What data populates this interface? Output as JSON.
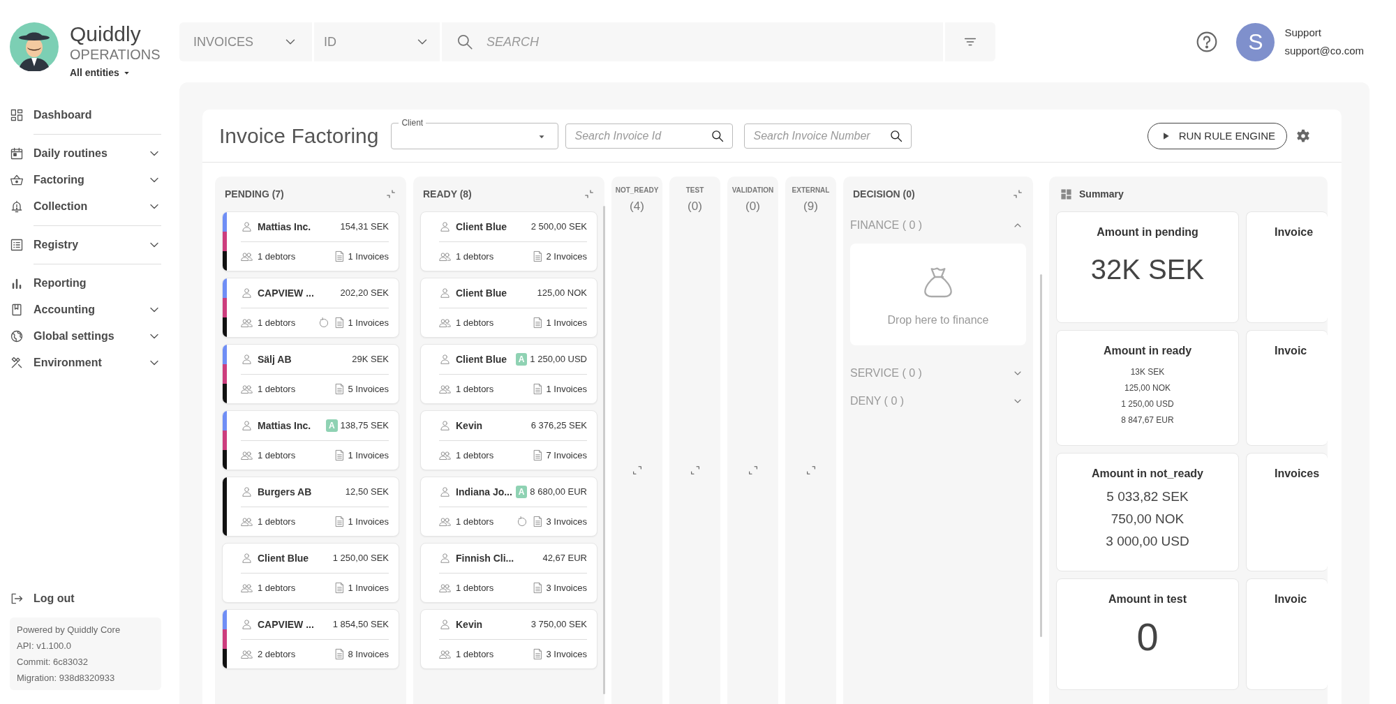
{
  "brand": {
    "name": "Quiddly",
    "subtitle": "OPERATIONS",
    "scope": "All entities"
  },
  "sidebar": {
    "groups": [
      [
        {
          "label": "Dashboard",
          "kind": "dashboard",
          "expandable": false
        }
      ],
      [
        {
          "label": "Daily routines",
          "kind": "calendar",
          "expandable": true
        },
        {
          "label": "Factoring",
          "kind": "basket",
          "expandable": true
        },
        {
          "label": "Collection",
          "kind": "bell",
          "expandable": true
        }
      ],
      [
        {
          "label": "Registry",
          "kind": "list",
          "expandable": true
        }
      ],
      [
        {
          "label": "Reporting",
          "kind": "bars",
          "expandable": false
        },
        {
          "label": "Accounting",
          "kind": "book",
          "expandable": true
        },
        {
          "label": "Global settings",
          "kind": "globe",
          "expandable": true
        },
        {
          "label": "Environment",
          "kind": "tools",
          "expandable": true
        }
      ]
    ],
    "logout": "Log out",
    "footer": [
      "Powered by Quiddly Core",
      "API: v1.100.0",
      "Commit: 6c83032",
      "Migration: 938d8320933"
    ]
  },
  "topbar": {
    "entity_select": "INVOICES",
    "field_select": "ID",
    "search": {
      "placeholder": "SEARCH"
    }
  },
  "user": {
    "initial": "S",
    "name": "Support",
    "email": "support@co.com"
  },
  "page": {
    "title": "Invoice Factoring",
    "client": {
      "label": "Client"
    },
    "invoice_id_search": {
      "placeholder": "Search Invoice Id"
    },
    "invoice_number_search": {
      "placeholder": "Search Invoice Number"
    },
    "run_button": "RUN RULE ENGINE"
  },
  "board": {
    "columns": [
      {
        "kind": "list",
        "title": "PENDING (7)",
        "cards": [
          {
            "client": "Mattias Inc.",
            "amount": "154,31 SEK",
            "debtors": "1 debtors",
            "invoices": "1 Invoices",
            "recurring": false,
            "strip": [
              {
                "color": "#6f8ef5"
              },
              {
                "color": "#cc3d7d"
              },
              {
                "color": "#111111"
              }
            ]
          },
          {
            "client": "CAPVIEW ...",
            "amount": "202,20 SEK",
            "debtors": "1 debtors",
            "invoices": "1 Invoices",
            "recurring": true,
            "strip": [
              {
                "color": "#6f8ef5"
              },
              {
                "color": "#cc3d7d"
              },
              {
                "color": "#111111"
              }
            ]
          },
          {
            "client": "Sälj AB",
            "amount": "29K SEK",
            "debtors": "1 debtors",
            "invoices": "5 Invoices",
            "recurring": false,
            "strip": [
              {
                "color": "#6f8ef5"
              },
              {
                "color": "#cc3d7d"
              },
              {
                "color": "#111111"
              }
            ]
          },
          {
            "client": "Mattias Inc.",
            "badge": "A",
            "amount": "138,75 SEK",
            "debtors": "1 debtors",
            "invoices": "1 Invoices",
            "recurring": false,
            "strip": [
              {
                "color": "#6f8ef5"
              },
              {
                "color": "#cc3d7d"
              },
              {
                "color": "#111111"
              }
            ]
          },
          {
            "client": "Burgers AB",
            "amount": "12,50 SEK",
            "debtors": "1 debtors",
            "invoices": "1 Invoices",
            "recurring": false,
            "strip": [
              {
                "color": "#111111"
              }
            ]
          },
          {
            "client": "Client Blue",
            "amount": "1 250,00 SEK",
            "debtors": "1 debtors",
            "invoices": "1 Invoices",
            "recurring": false
          },
          {
            "client": "CAPVIEW ...",
            "amount": "1 854,50 SEK",
            "debtors": "2 debtors",
            "invoices": "8 Invoices",
            "recurring": false,
            "strip": [
              {
                "color": "#6f8ef5"
              },
              {
                "color": "#cc3d7d"
              },
              {
                "color": "#111111"
              }
            ]
          }
        ]
      },
      {
        "kind": "list",
        "title": "READY (8)",
        "cards": [
          {
            "client": "Client Blue",
            "amount": "2 500,00 SEK",
            "debtors": "1 debtors",
            "invoices": "2 Invoices",
            "recurring": false
          },
          {
            "client": "Client Blue",
            "amount": "125,00 NOK",
            "debtors": "1 debtors",
            "invoices": "1 Invoices",
            "recurring": false
          },
          {
            "client": "Client Blue",
            "badge": "A",
            "amount": "1 250,00 USD",
            "debtors": "1 debtors",
            "invoices": "1 Invoices",
            "recurring": false
          },
          {
            "client": "Kevin",
            "amount": "6 376,25 SEK",
            "debtors": "1 debtors",
            "invoices": "7 Invoices",
            "recurring": false
          },
          {
            "client": "Indiana Jo...",
            "badge": "A",
            "amount": "8 680,00 EUR",
            "debtors": "1 debtors",
            "invoices": "3 Invoices",
            "recurring": true
          },
          {
            "client": "Finnish Cli...",
            "amount": "42,67 EUR",
            "debtors": "1 debtors",
            "invoices": "3 Invoices",
            "recurring": false
          },
          {
            "client": "Kevin",
            "amount": "3 750,00 SEK",
            "debtors": "1 debtors",
            "invoices": "3 Invoices",
            "recurring": false
          }
        ]
      },
      {
        "kind": "collapsed",
        "title": "NOT_READY",
        "count": "(4)"
      },
      {
        "kind": "collapsed",
        "title": "TEST",
        "count": "(0)"
      },
      {
        "kind": "collapsed",
        "title": "VALIDATION",
        "count": "(0)"
      },
      {
        "kind": "collapsed",
        "title": "EXTERNAL",
        "count": "(9)"
      },
      {
        "kind": "decision",
        "title": "DECISION (0)",
        "sections": [
          {
            "label": "FINANCE ( 0 )",
            "expanded": true,
            "drop_text": "Drop here to finance"
          },
          {
            "label": "SERVICE ( 0 )",
            "expanded": false
          },
          {
            "label": "DENY ( 0 )",
            "expanded": false
          }
        ]
      }
    ]
  },
  "summary": {
    "title": "Summary",
    "columns": [
      [
        {
          "title": "Amount in pending",
          "kind": "big",
          "values": [
            "32K SEK"
          ]
        },
        {
          "title": "Amount in ready",
          "kind": "small",
          "values": [
            "13K SEK",
            "125,00 NOK",
            "1 250,00 USD",
            "8 847,67 EUR"
          ]
        },
        {
          "title": "Amount in not_ready",
          "kind": "medium",
          "values": [
            "5 033,82 SEK",
            "750,00 NOK",
            "3 000,00 USD"
          ]
        },
        {
          "title": "Amount in test",
          "kind": "huge",
          "values": [
            "0"
          ]
        }
      ],
      [
        {
          "title": "Invoice"
        },
        {
          "title": "Invoic"
        },
        {
          "title": "Invoices"
        },
        {
          "title": "Invoic"
        }
      ]
    ]
  }
}
